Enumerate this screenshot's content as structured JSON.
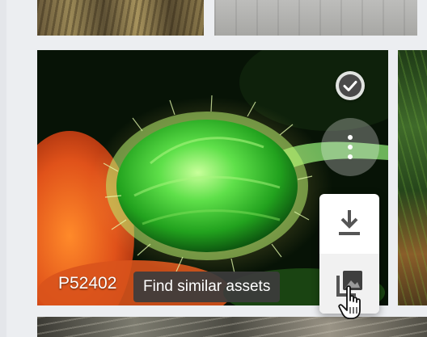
{
  "asset": {
    "label": "P52402",
    "selected": true
  },
  "tooltip": {
    "text": "Find similar assets"
  },
  "actions": {
    "check_icon": "check-circle-icon",
    "more_icon": "more-vertical-icon",
    "download_icon": "download-icon",
    "find_similar_icon": "find-similar-icon"
  },
  "colors": {
    "page_background": "#eceef1",
    "tooltip_background": "#3c3c3c",
    "popover_background": "#ffffff",
    "icon_gray": "#555555"
  }
}
